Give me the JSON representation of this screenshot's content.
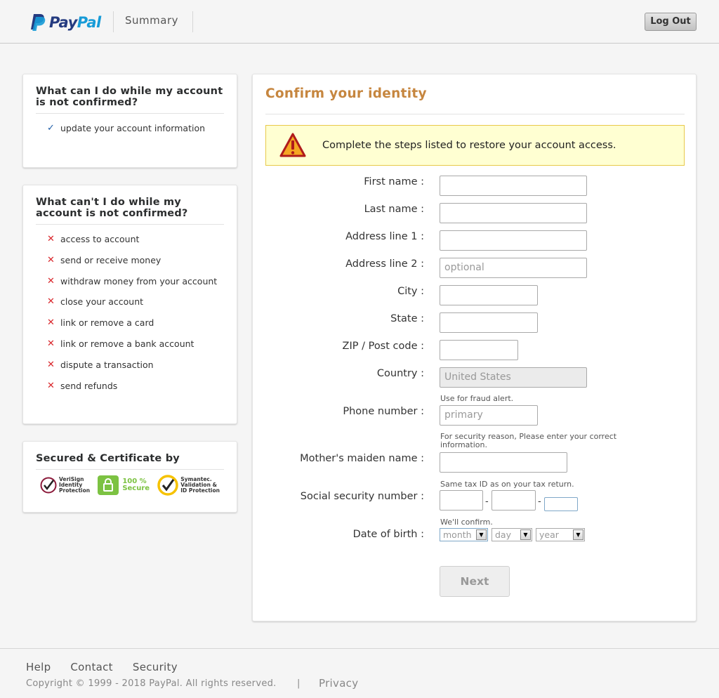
{
  "header": {
    "logo_pay": "Pay",
    "logo_pal": "Pal",
    "nav_summary": "Summary",
    "logout_label": "Log Out"
  },
  "can_panel": {
    "title": "What can I do while my account is not confirmed?",
    "items": [
      {
        "icon": "check-icon",
        "label": "update your account information"
      }
    ]
  },
  "cant_panel": {
    "title": "What can't I do while my account is not confirmed?",
    "items": [
      {
        "icon": "cross-icon",
        "label": "access to account"
      },
      {
        "icon": "cross-icon",
        "label": "send or receive money"
      },
      {
        "icon": "cross-icon",
        "label": "withdraw money from your account"
      },
      {
        "icon": "cross-icon",
        "label": "close your account"
      },
      {
        "icon": "cross-icon",
        "label": "link or remove a card"
      },
      {
        "icon": "cross-icon",
        "label": "link or remove a bank account"
      },
      {
        "icon": "cross-icon",
        "label": "dispute a transaction"
      },
      {
        "icon": "cross-icon",
        "label": "send refunds"
      }
    ]
  },
  "secured_panel": {
    "title": "Secured & Certificate by",
    "badges": [
      {
        "icon": "verisign-badge-icon",
        "line1": "VeriSign",
        "line2": "Identity",
        "line3": "Protection"
      },
      {
        "icon": "lock-badge-icon",
        "line1": "100 %",
        "line2": "Secure"
      },
      {
        "icon": "symantec-badge-icon",
        "line1": "Symantec.",
        "line2": "Validation &",
        "line3": "ID Protection"
      }
    ]
  },
  "form": {
    "title": "Confirm your identity",
    "alert": "Complete the steps listed to restore your account access.",
    "labels": {
      "first_name": "First name :",
      "last_name": "Last name :",
      "address1": "Address line 1 :",
      "address2": "Address line 2 :",
      "city": "City :",
      "state": "State :",
      "zip": "ZIP / Post code :",
      "country": "Country :",
      "phone": "Phone number :",
      "maiden": "Mother's maiden name :",
      "ssn": "Social security number :",
      "dob": "Date of birth :"
    },
    "values": {
      "first_name": "",
      "last_name": "",
      "address1": "",
      "city": "",
      "state": "",
      "zip": "",
      "country": "United States",
      "maiden": "",
      "ssn1": "",
      "ssn2": "",
      "ssn3": ""
    },
    "placeholders": {
      "address2": "optional",
      "phone": "primary"
    },
    "hints": {
      "phone": "Use for fraud alert.",
      "maiden_line1": "For security reason, Please enter your correct",
      "maiden_line2": "information.",
      "ssn": "Same tax ID as on your tax return.",
      "dob": "We'll confirm."
    },
    "ssn_separator": "-",
    "dob_selects": {
      "month": "month",
      "day": "day",
      "year": "year"
    },
    "next_label": "Next"
  },
  "footer": {
    "links": [
      "Help",
      "Contact",
      "Security"
    ],
    "copyright": "Copyright © 1999 - 2018 PayPal. All rights reserved.",
    "pipe": "|",
    "privacy": "Privacy"
  }
}
